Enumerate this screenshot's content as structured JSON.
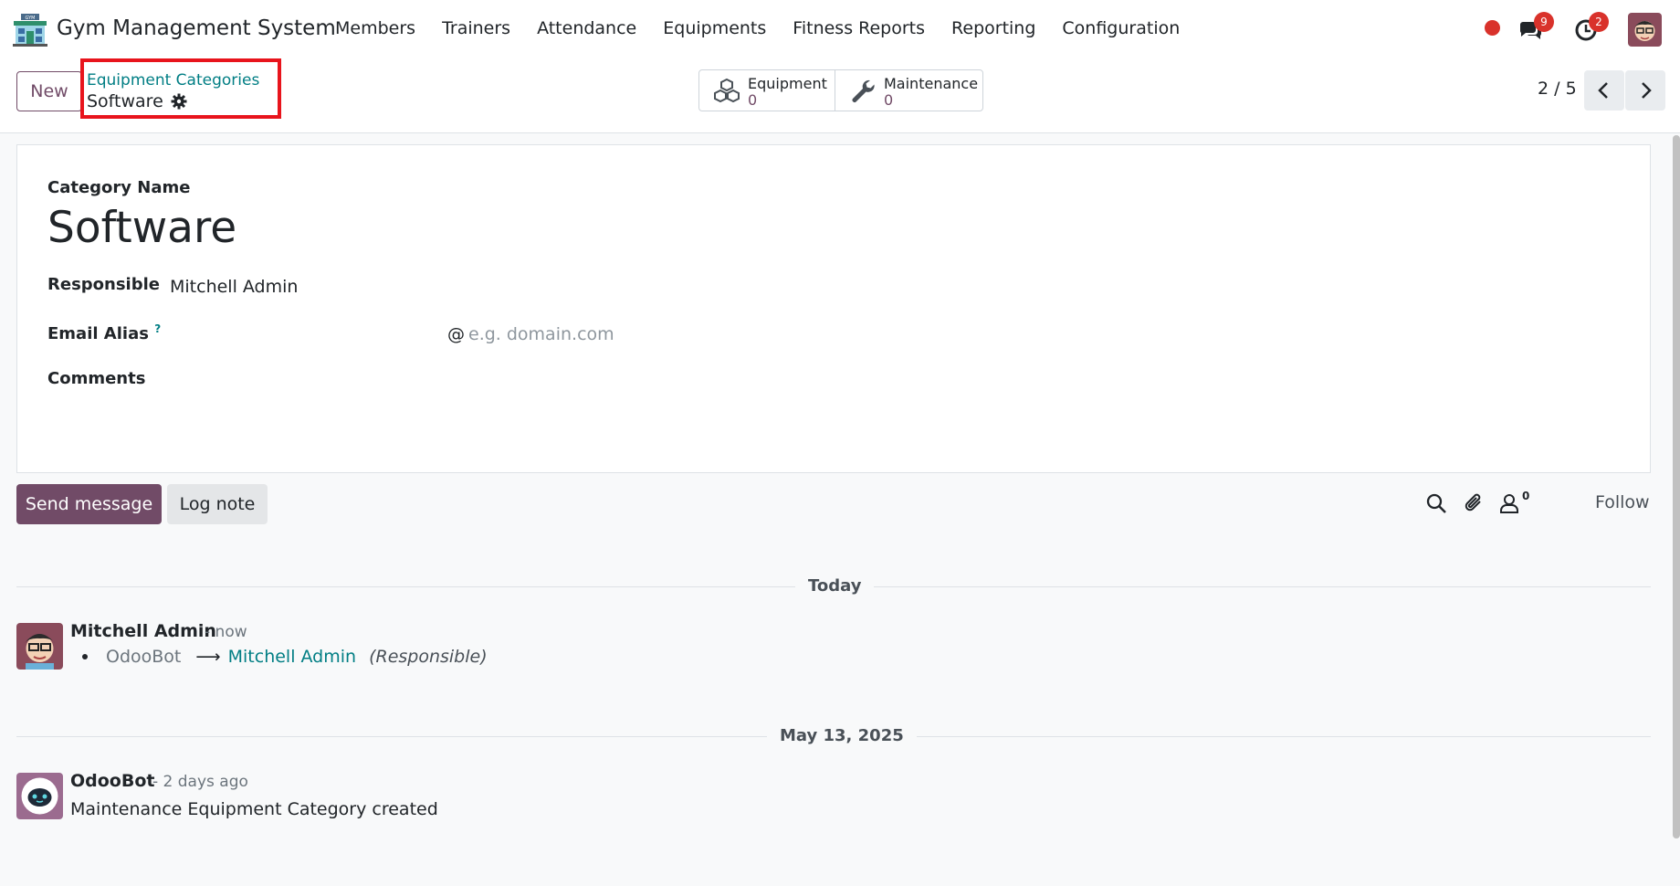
{
  "navbar": {
    "app_name": "Gym Management System",
    "menu": [
      "Members",
      "Trainers",
      "Attendance",
      "Equipments",
      "Fitness Reports",
      "Reporting",
      "Configuration"
    ],
    "messages_badge": "9",
    "activities_badge": "2",
    "brand_color": "#714b67"
  },
  "control": {
    "new_label": "New",
    "breadcrumb_parent": "Equipment Categories",
    "breadcrumb_current": "Software",
    "stat_equipment_label": "Equipment",
    "stat_equipment_value": "0",
    "stat_maintenance_label": "Maintenance",
    "stat_maintenance_value": "0",
    "pager": "2 / 5"
  },
  "form": {
    "category_name_label": "Category Name",
    "category_name_value": "Software",
    "responsible_label": "Responsible",
    "responsible_value": "Mitchell Admin",
    "email_alias_label": "Email Alias",
    "email_alias_help": "?",
    "email_alias_at": "@",
    "email_alias_placeholder": "e.g. domain.com",
    "comments_label": "Comments"
  },
  "chatter": {
    "send_message_label": "Send message",
    "log_note_label": "Log note",
    "followers_count": "0",
    "follow_label": "Follow",
    "separators": [
      "Today",
      "May 13, 2025"
    ],
    "messages": [
      {
        "author": "Mitchell Admin",
        "time": "- now",
        "tracking": {
          "old": "OdooBot",
          "arrow": "⟶",
          "new": "Mitchell Admin",
          "field": "(Responsible)"
        }
      },
      {
        "author": "OdooBot",
        "time": "- 2 days ago",
        "body": "Maintenance Equipment Category created"
      }
    ]
  }
}
